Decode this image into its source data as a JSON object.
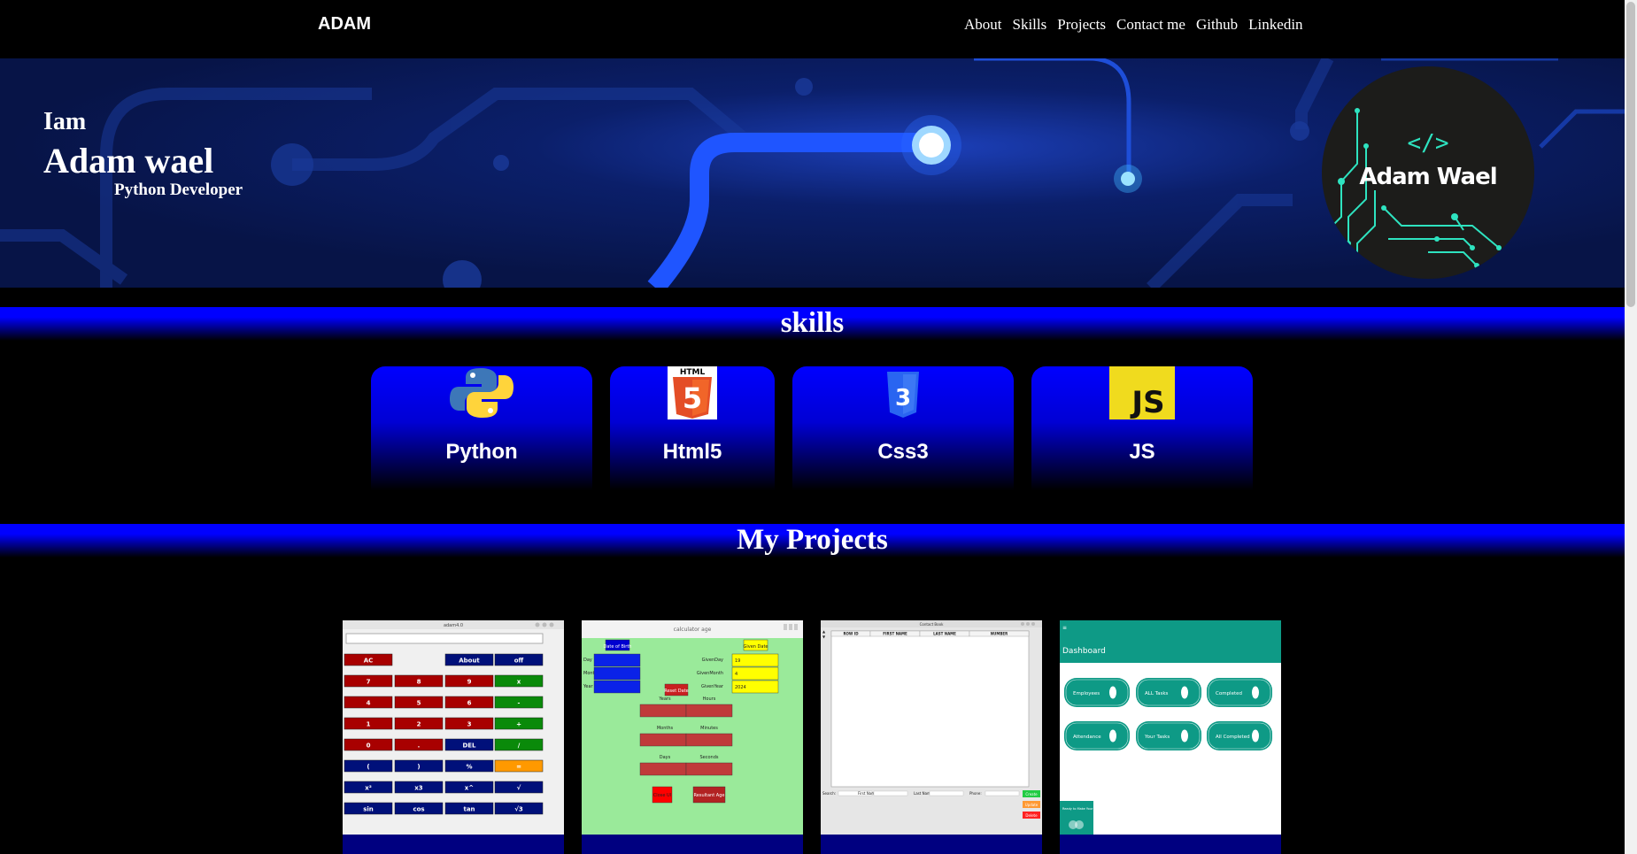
{
  "nav": {
    "brand": "ADAM",
    "links": [
      "About",
      "Skills",
      "Projects",
      "Contact me",
      "Github",
      "Linkedin"
    ]
  },
  "hero": {
    "intro": "Iam",
    "name": "Adam wael",
    "role": "Python Developer",
    "avatar_code": "</>",
    "avatar_text": "Adam Wael"
  },
  "skills": {
    "title": "skills",
    "items": [
      {
        "label": "Python",
        "icon": "python-icon"
      },
      {
        "label": "Html5",
        "icon": "html5-icon"
      },
      {
        "label": "Css3",
        "icon": "css3-icon"
      },
      {
        "label": "JS",
        "icon": "js-icon"
      }
    ]
  },
  "projects": {
    "title": "My Projects",
    "items": [
      {
        "name": "calculator",
        "screen": {
          "title": "adam4.0",
          "buttons": [
            "AC",
            "About",
            "off",
            "7",
            "8",
            "9",
            "x",
            "4",
            "5",
            "6",
            "-",
            "1",
            "2",
            "3",
            "+",
            "0",
            ".",
            "DEL",
            "/",
            "(",
            ")",
            "%",
            "=",
            "x²",
            "x3",
            "x^",
            "√",
            "sin",
            "cos",
            "tan",
            "√3"
          ]
        }
      },
      {
        "name": "age-calculator",
        "screen": {
          "title": "calculator age",
          "labels": [
            "Date of Birth",
            "Given Date",
            "Day",
            "Month",
            "Year",
            "GivenDay",
            "GivenMonth",
            "GivenYear",
            "Reset Date",
            "Years",
            "Hours",
            "Months",
            "Minutes",
            "Days",
            "Seconds",
            "Close UI",
            "Resultant Age"
          ],
          "values": [
            "19",
            "4",
            "2024"
          ]
        }
      },
      {
        "name": "contact-book",
        "screen": {
          "title": "Contact Book",
          "columns": [
            "ROW ID",
            "FIRST NAME",
            "LAST NAME",
            "NUMBER"
          ],
          "fields": [
            "Search:",
            "First Name:",
            "Last Name:",
            "Phone:"
          ],
          "actions": [
            "Create",
            "Update",
            "Delete"
          ]
        }
      },
      {
        "name": "dashboard",
        "screen": {
          "title": "Dashboard",
          "tiles": [
            "Employees",
            "ALL Tasks",
            "Completed",
            "Attendance",
            "Your Tasks",
            "All Completed"
          ],
          "footer": "Ready to Make Your"
        }
      }
    ]
  },
  "colors": {
    "accent": "#0000ff",
    "hero_bg": "#071447",
    "card_bottom": "#000080"
  }
}
